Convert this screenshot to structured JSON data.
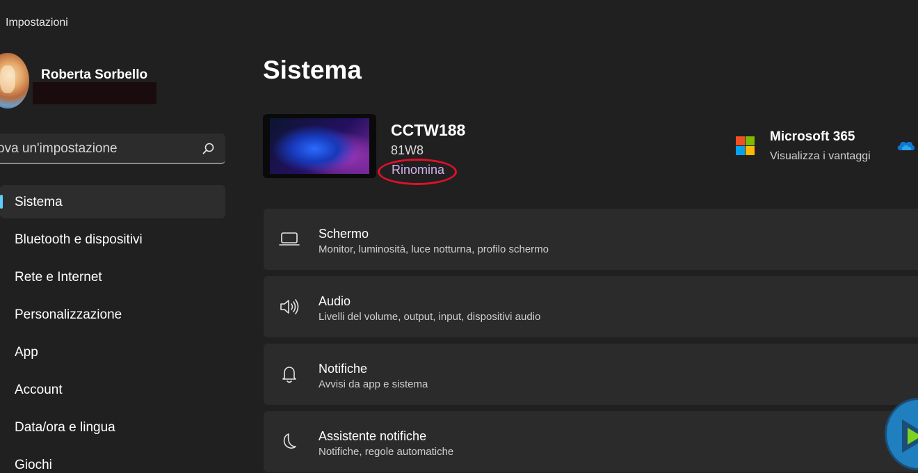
{
  "window": {
    "title": "Impostazioni"
  },
  "profile": {
    "name": "Roberta Sorbello"
  },
  "search": {
    "placeholder": "ova un'impostazione",
    "icon": "search-icon"
  },
  "sidebar": {
    "items": [
      {
        "label": "Sistema",
        "active": true
      },
      {
        "label": "Bluetooth e dispositivi"
      },
      {
        "label": "Rete e Internet"
      },
      {
        "label": "Personalizzazione"
      },
      {
        "label": "App"
      },
      {
        "label": "Account"
      },
      {
        "label": "Data/ora e lingua"
      },
      {
        "label": "Giochi"
      }
    ]
  },
  "main": {
    "title": "Sistema",
    "device": {
      "name": "CCTW188",
      "model": "81W8",
      "rename_label": "Rinomina"
    },
    "ms365": {
      "title": "Microsoft 365",
      "subtitle": "Visualizza i vantaggi"
    },
    "cards": [
      {
        "icon": "monitor-icon",
        "title": "Schermo",
        "subtitle": "Monitor, luminosità, luce notturna, profilo schermo"
      },
      {
        "icon": "speaker-icon",
        "title": "Audio",
        "subtitle": "Livelli del volume, output, input, dispositivi audio"
      },
      {
        "icon": "bell-icon",
        "title": "Notifiche",
        "subtitle": "Avvisi da app e sistema"
      },
      {
        "icon": "moon-icon",
        "title": "Assistente notifiche",
        "subtitle": "Notifiche, regole automatiche"
      }
    ]
  },
  "colors": {
    "background": "#202020",
    "card": "#2b2b2b",
    "accent": "#60cdff",
    "link": "#d4b4ee",
    "annotation": "#e0102a"
  }
}
